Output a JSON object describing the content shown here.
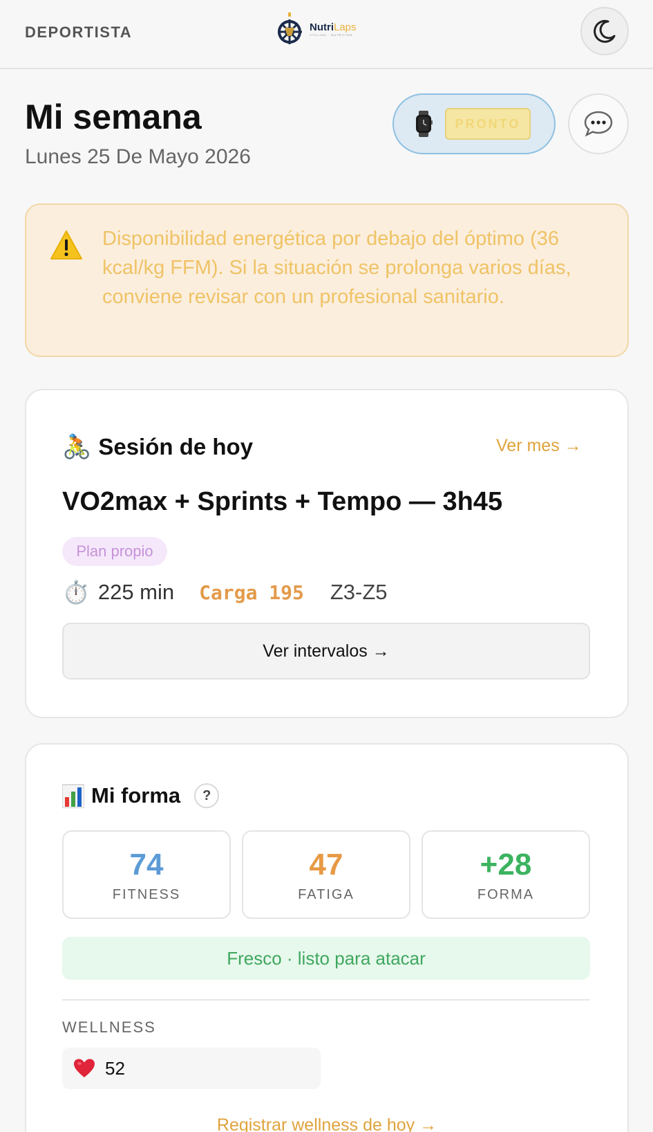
{
  "header": {
    "role": "DEPORTISTA",
    "brand": {
      "name_part1": "Nutri",
      "name_part2": "Laps",
      "tagline": "CYCLING · NUTRITION"
    }
  },
  "week": {
    "title": "Mi semana",
    "date": "Lunes 25 De Mayo 2026",
    "device_badge": "PRONTO"
  },
  "alert": {
    "text": "Disponibilidad energética por debajo del óptimo (36 kcal/kg FFM). Si la situación se prolonga varios días, conviene revisar con un profesional sanitario."
  },
  "session": {
    "emoji": "🚴",
    "title": "Sesión de hoy",
    "link": "Ver mes →",
    "workout": "VO2max + Sprints + Tempo — 3h45",
    "tag": "Plan propio",
    "stopwatch_emoji": "⏱️",
    "duration": "225 min",
    "load": "Carga 195",
    "zones": "Z3-Z5",
    "intervals_button": "Ver intervalos →"
  },
  "forma": {
    "title": "Mi forma",
    "help": "?",
    "metrics": [
      {
        "value": "74",
        "label": "FITNESS",
        "color": "#5c9bd6"
      },
      {
        "value": "47",
        "label": "FATIGA",
        "color": "#e79a45"
      },
      {
        "value": "+28",
        "label": "FORMA",
        "color": "#3cb35f"
      }
    ],
    "status": "Fresco · listo para atacar",
    "wellness_label": "WELLNESS",
    "wellness_value": "52",
    "register_link": "Registrar wellness de hoy →"
  },
  "colors": {
    "accent": "#e0a33c",
    "alert_text": "#efc366",
    "device_pill_border": "#8ec0e2",
    "status_green": "#3fa75f"
  },
  "icons": {
    "theme_toggle": "moon-icon",
    "chat": "chat-bubble-icon",
    "alert": "warning-icon",
    "chart": "bar-chart-icon",
    "wellness": "heart-icon",
    "device": "smartwatch-icon"
  }
}
